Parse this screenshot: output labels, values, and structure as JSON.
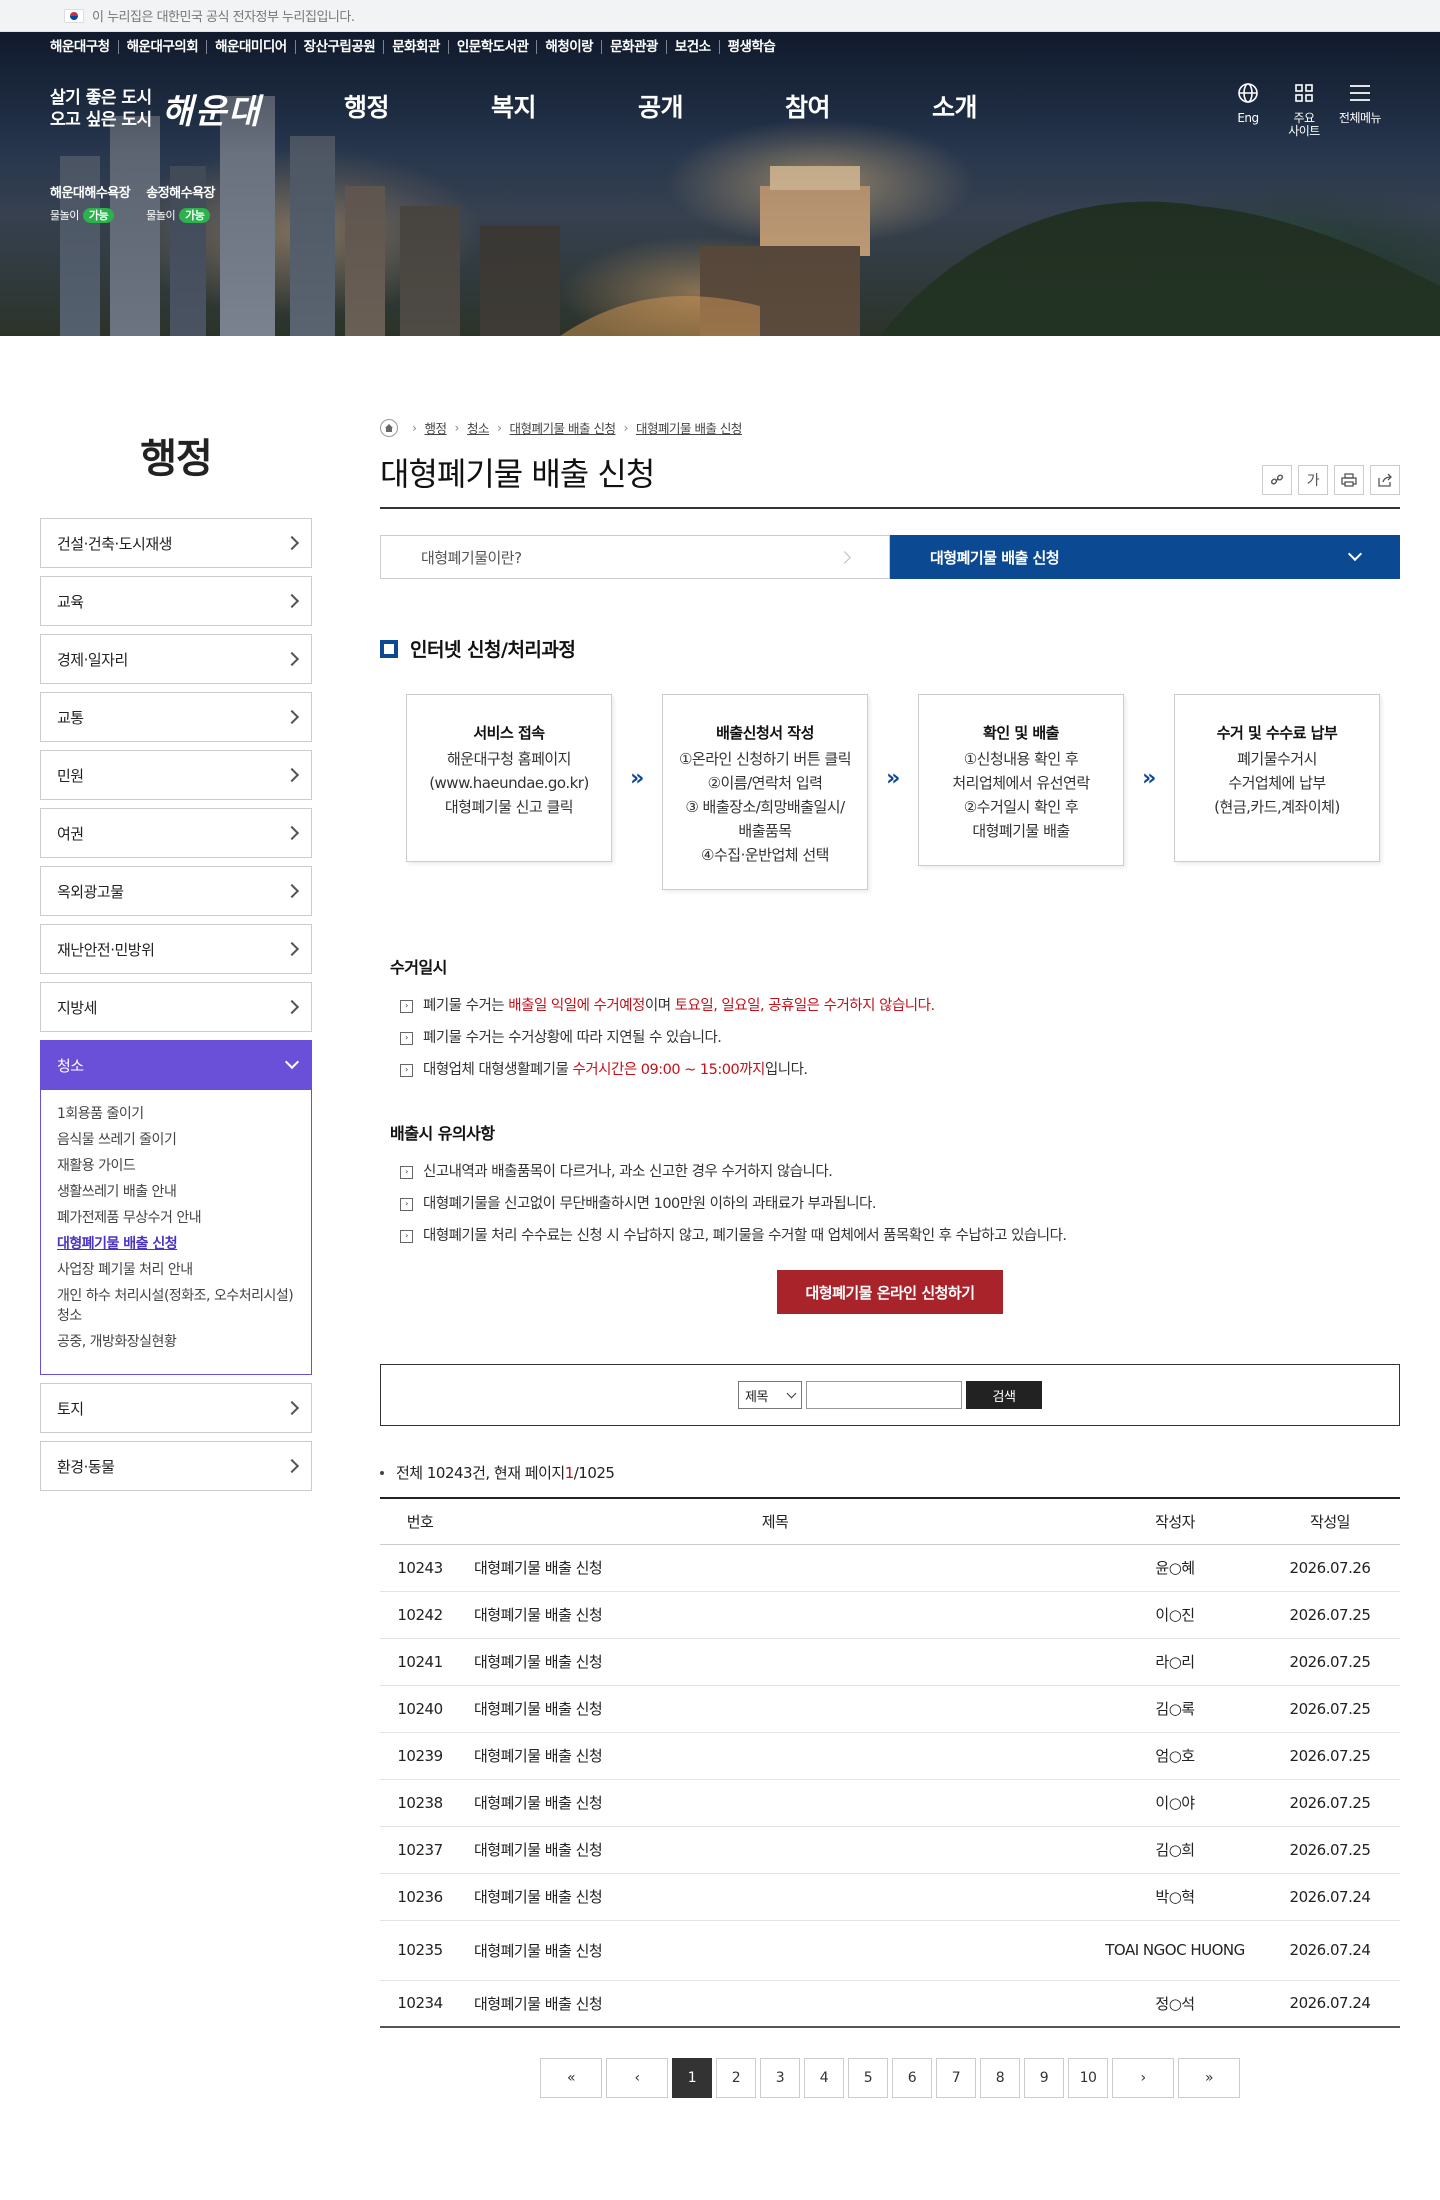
{
  "gov_banner": "이 누리집은 대한민국 공식 전자정부 누리집입니다.",
  "header": {
    "top_links": [
      "해운대구청",
      "해운대구의회",
      "해운대미디어",
      "장산구립공원",
      "문화회관",
      "인문학도서관",
      "해청이랑",
      "문화관광",
      "보건소",
      "평생학습"
    ],
    "slogan_line1": "살기 좋은 도시",
    "slogan_line2": "오고 싶은 도시",
    "logo": "해운대",
    "main_nav": [
      "행정",
      "복지",
      "공개",
      "참여",
      "소개"
    ],
    "utils": {
      "eng": "Eng",
      "sites_line1": "주요",
      "sites_line2": "사이트",
      "all_menu": "전체메뉴"
    },
    "beaches": [
      {
        "name": "해운대해수욕장",
        "label": "물놀이",
        "status": "가능"
      },
      {
        "name": "송정해수욕장",
        "label": "물놀이",
        "status": "가능"
      }
    ]
  },
  "sidebar": {
    "title": "행정",
    "items_before": [
      "건설·건축·도시재생",
      "교육",
      "경제·일자리",
      "교통",
      "민원",
      "여권",
      "옥외광고물",
      "재난안전·민방위",
      "지방세"
    ],
    "active": "청소",
    "sub_items": [
      "1회용품 줄이기",
      "음식물 쓰레기 줄이기",
      "재활용 가이드",
      "생활쓰레기 배출 안내",
      "폐가전제품 무상수거 안내",
      "대형폐기물 배출 신청",
      "사업장 폐기물 처리 안내",
      "개인 하수 처리시설(정화조, 오수처리시설) 청소",
      "공중, 개방화장실현황"
    ],
    "current_sub": "대형폐기물 배출 신청",
    "items_after": [
      "토지",
      "환경·동물"
    ]
  },
  "breadcrumb": [
    "행정",
    "청소",
    "대형폐기물 배출 신청",
    "대형폐기물 배출 신청"
  ],
  "page_title": "대형폐기물 배출 신청",
  "tools": {
    "font": "가"
  },
  "tabs": {
    "tab1": "대형폐기물이란?",
    "tab2": "대형폐기물 배출 신청"
  },
  "process": {
    "title": "인터넷 신청/처리과정",
    "steps": [
      {
        "title": "서비스 접속",
        "lines": [
          "해운대구청 홈페이지",
          "(www.haeundae.go.kr)",
          "대형폐기물 신고 클릭"
        ]
      },
      {
        "title": "배출신청서 작성",
        "lines": [
          "①온라인 신청하기 버튼 클릭",
          "②이름/연락처 입력",
          "③ 배출장소/희망배출일시/",
          "배출품목",
          "④수집·운반업체 선택"
        ]
      },
      {
        "title": "확인 및 배출",
        "lines": [
          "①신청내용 확인 후",
          "처리업체에서 유선연락",
          "②수거일시 확인 후",
          "대형폐기물 배출"
        ]
      },
      {
        "title": "수거 및 수수료 납부",
        "lines": [
          "폐기물수거시",
          "수거업체에 납부",
          "(현금,카드,계좌이체)"
        ]
      }
    ],
    "arrow": "»"
  },
  "collection": {
    "title": "수거일시",
    "b1": {
      "a": "폐기물 수거는 ",
      "r1": "배출일 익일에 수거예정",
      "b": "이며 ",
      "r2": "토요일, 일요일, 공휴일은 수거하지 않습니다."
    },
    "b2": "폐기물 수거는 수거상황에 따라 지연될 수 있습니다.",
    "b3": {
      "a": "대형업체 대형생활폐기물 ",
      "r": "수거시간은 09:00 ~ 15:00까지",
      "b": "입니다."
    }
  },
  "caution": {
    "title": "배출시 유의사항",
    "items": [
      "신고내역과 배출품목이 다르거나, 과소 신고한 경우 수거하지 않습니다.",
      "대형폐기물을 신고없이 무단배출하시면 100만원 이하의 과태료가 부과됩니다.",
      "대형폐기물 처리 수수료는 신청 시 수납하지 않고, 폐기물을 수거할 때 업체에서 품목확인 후 수납하고 있습니다."
    ]
  },
  "cta_label": "대형폐기물 온라인 신청하기",
  "search": {
    "select": "제목",
    "input_value": "",
    "button": "검색"
  },
  "board": {
    "total_prefix": "전체 10243건, 현재 페이지 ",
    "current_page": "1",
    "total_suffix": "/1025",
    "headers": {
      "num": "번호",
      "title": "제목",
      "writer": "작성자",
      "date": "작성일"
    },
    "rows": [
      {
        "num": "10243",
        "title": "대형폐기물 배출 신청",
        "writer": "윤○혜",
        "date": "2026.07.26"
      },
      {
        "num": "10242",
        "title": "대형폐기물 배출 신청",
        "writer": "이○진",
        "date": "2026.07.25"
      },
      {
        "num": "10241",
        "title": "대형폐기물 배출 신청",
        "writer": "라○리",
        "date": "2026.07.25"
      },
      {
        "num": "10240",
        "title": "대형폐기물 배출 신청",
        "writer": "김○록",
        "date": "2026.07.25"
      },
      {
        "num": "10239",
        "title": "대형폐기물 배출 신청",
        "writer": "엄○호",
        "date": "2026.07.25"
      },
      {
        "num": "10238",
        "title": "대형폐기물 배출 신청",
        "writer": "이○야",
        "date": "2026.07.25"
      },
      {
        "num": "10237",
        "title": "대형폐기물 배출 신청",
        "writer": "김○희",
        "date": "2026.07.25"
      },
      {
        "num": "10236",
        "title": "대형폐기물 배출 신청",
        "writer": "박○혁",
        "date": "2026.07.24"
      },
      {
        "num": "10235",
        "title": "대형폐기물 배출 신청",
        "writer": "TOAI NGOC HUONG",
        "date": "2026.07.24"
      },
      {
        "num": "10234",
        "title": "대형폐기물 배출 신청",
        "writer": "정○석",
        "date": "2026.07.24"
      }
    ]
  },
  "paging": {
    "first": "«",
    "prev": "‹",
    "pages": [
      "1",
      "2",
      "3",
      "4",
      "5",
      "6",
      "7",
      "8",
      "9",
      "10"
    ],
    "next": "›",
    "last": "»"
  }
}
